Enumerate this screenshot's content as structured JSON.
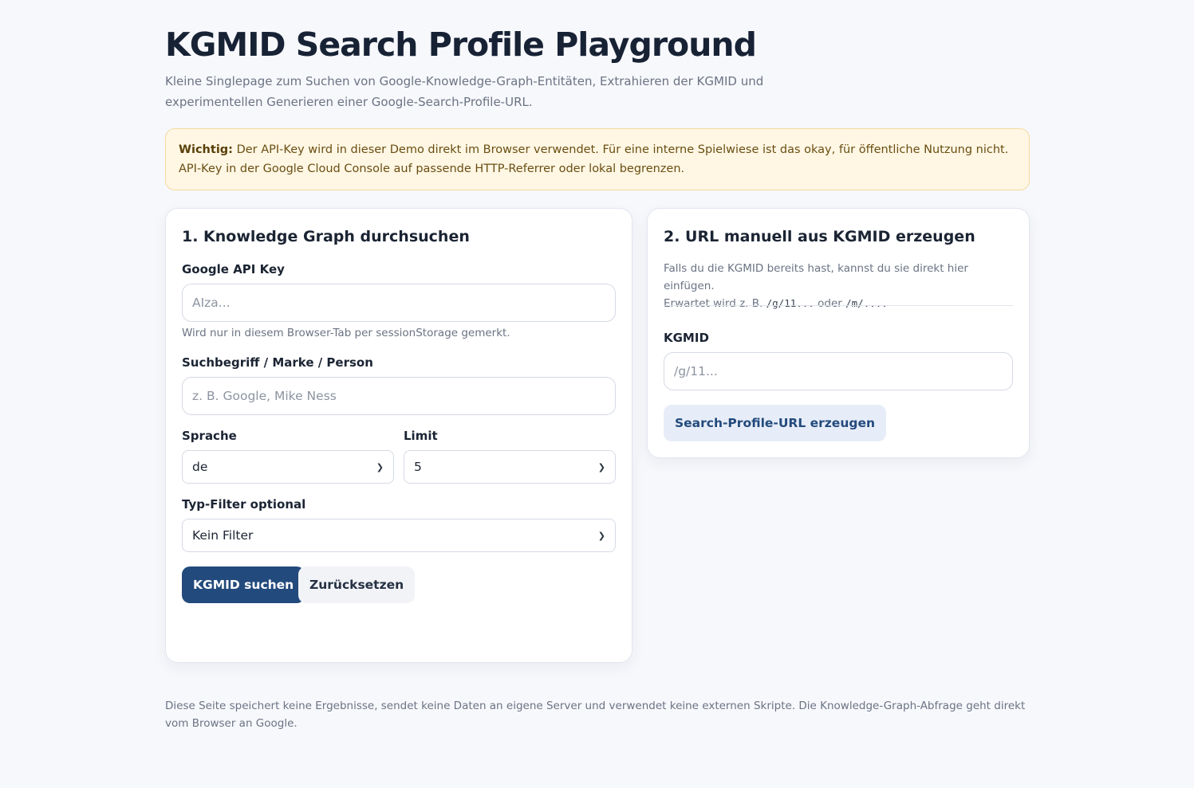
{
  "header": {
    "title": "KGMID Search Profile Playground",
    "intro": "Kleine Singlepage zum Suchen von Google-Knowledge-Graph-Entitäten, Extrahieren der KGMID und experimentellen Generieren einer Google-Search-Profile-URL."
  },
  "notice": {
    "label": "Wichtig:",
    "text": "Der API-Key wird in dieser Demo direkt im Browser verwendet. Für eine interne Spielwiese ist das okay, für öffentliche Nutzung nicht. API-Key in der Google Cloud Console auf passende HTTP-Referrer oder lokal begrenzen."
  },
  "search_card": {
    "title": "1. Knowledge Graph durchsuchen",
    "api_key": {
      "label": "Google API Key",
      "placeholder": "AIza...",
      "value": "",
      "hint": "Wird nur in diesem Browser-Tab per sessionStorage gemerkt."
    },
    "query": {
      "label": "Suchbegriff / Marke / Person",
      "placeholder": "z. B. Google, Mike Ness",
      "value": ""
    },
    "language": {
      "label": "Sprache",
      "selected": "de"
    },
    "limit": {
      "label": "Limit",
      "selected": "5"
    },
    "type_filter": {
      "label": "Typ-Filter optional",
      "selected": "Kein Filter"
    },
    "search_button": "KGMID suchen",
    "reset_button": "Zurücksetzen"
  },
  "manual_card": {
    "title": "2. URL manuell aus KGMID erzeugen",
    "desc_line1": "Falls du die KGMID bereits hast, kannst du sie direkt hier einfügen.",
    "desc_prefix": "Erwartet wird z. B.",
    "example_1": "/g/11...",
    "desc_or": "oder",
    "example_2": "/m/....",
    "kgmid": {
      "label": "KGMID",
      "placeholder": "/g/11...",
      "value": ""
    },
    "generate_button": "Search-Profile-URL erzeugen"
  },
  "footer": {
    "text": "Diese Seite speichert keine Ergebnisse, sendet keine Daten an eigene Server und verwendet keine externen Skripte. Die Knowledge-Graph-Abfrage geht direkt vom Browser an Google."
  }
}
